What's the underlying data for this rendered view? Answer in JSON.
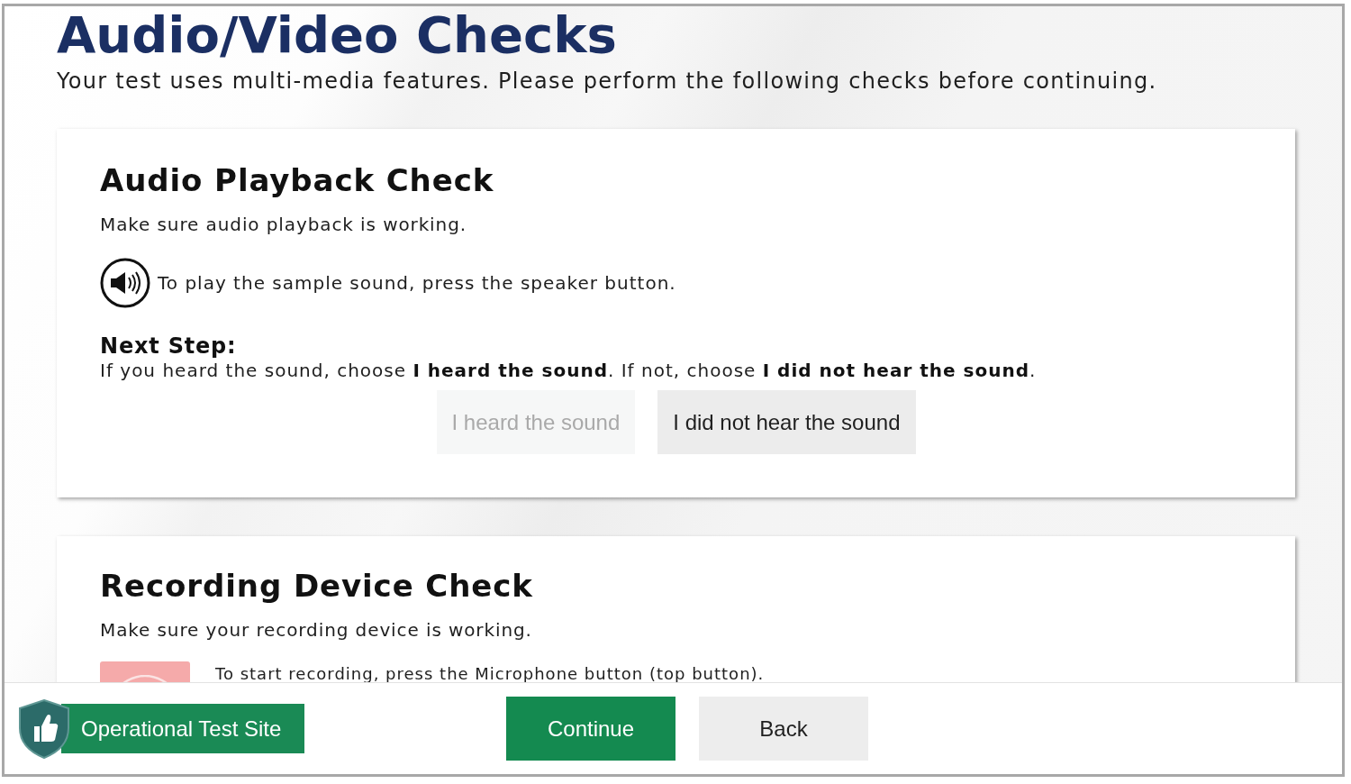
{
  "page": {
    "title": "Audio/Video Checks",
    "subtitle": "Your test uses multi-media features. Please perform the following checks before continuing."
  },
  "checks": [
    {
      "kind": "playback",
      "title": "Audio Playback Check",
      "description": "Make sure audio playback is working.",
      "instruction": "To play the sample sound, press the speaker button.",
      "next_step": {
        "heading": "Next Step:",
        "text": "If you heard the sound, choose **I heard the sound**. If not, choose **I did not hear the sound**."
      },
      "buttons": [
        {
          "label": "I heard the sound",
          "disabled": true
        },
        {
          "label": "I did not hear the sound",
          "disabled": false
        }
      ]
    },
    {
      "kind": "recording",
      "title": "Recording Device Check",
      "description": "Make sure your recording device is working.",
      "instruction": "To start recording, press the Microphone button (top button)."
    }
  ],
  "footer": {
    "badge": "Operational Test Site",
    "buttons": [
      {
        "label": "Continue",
        "kind": "primary"
      },
      {
        "label": "Back",
        "kind": "secondary"
      }
    ]
  }
}
